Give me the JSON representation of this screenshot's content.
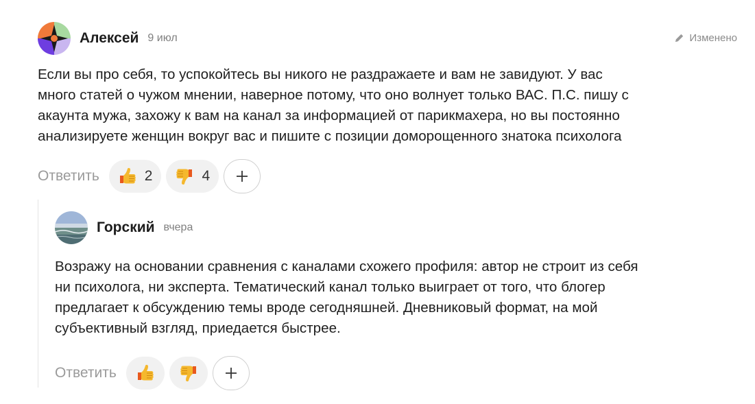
{
  "comments": [
    {
      "author": "Алексей",
      "date": "9 июл",
      "edited_label": "Изменено",
      "lines": [
        "Если вы про себя, то успокойтесь вы никого не раздражаете и вам не завидуют. У вас",
        "много статей о чужом мнении, наверное потому, что оно волнует только ВАС. П.С. пишу с",
        "акаунта мужа, захожу к вам на канал за информацией от парикмахера, но вы постоянно",
        "анализируете женщин вокруг вас и пишите с позиции доморощенного знатока психолога"
      ],
      "reply_label": "Ответить",
      "likes": "2",
      "dislikes": "4",
      "add_label": "+"
    },
    {
      "author": "Горский",
      "date": "вчера",
      "lines": [
        "Возражу на основании сравнения с каналами схожего профиля: автор не строит из себя",
        "ни психолога, ни эксперта. Тематический канал только выиграет от того, что блогер",
        "предлагает к обсуждению темы вроде сегодняшней. Дневниковый формат, на мой",
        "субъективный взгляд, приедается быстрее."
      ],
      "reply_label": "Ответить",
      "add_label": "+"
    }
  ],
  "icons": {
    "edit": "pencil-icon",
    "like": "thumbs-up-emoji",
    "dislike": "thumbs-down-emoji",
    "add": "plus-icon"
  },
  "colors": {
    "muted_text": "#9a9a9a",
    "reaction_bg": "#f1f1f1",
    "thread_line": "#e3e3e3"
  }
}
